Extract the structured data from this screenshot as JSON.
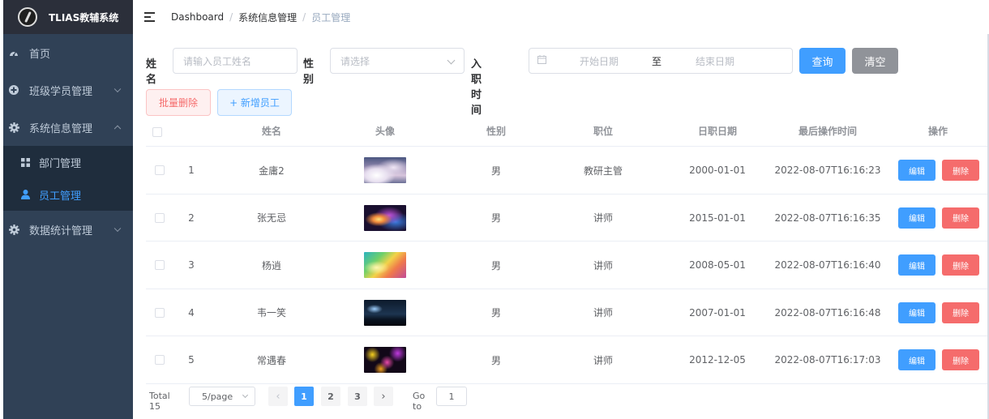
{
  "brand": {
    "title": "TLIAS教辅系统"
  },
  "sidebar": {
    "items": [
      {
        "label": "首页",
        "icon": "dashboard-icon"
      },
      {
        "label": "班级学员管理",
        "icon": "plus-circle-icon",
        "expanded": false
      },
      {
        "label": "系统信息管理",
        "icon": "gear-icon",
        "expanded": true,
        "children": [
          {
            "label": "部门管理",
            "icon": "grid-icon",
            "active": false
          },
          {
            "label": "员工管理",
            "icon": "user-icon",
            "active": true
          }
        ]
      },
      {
        "label": "数据统计管理",
        "icon": "gear-icon",
        "expanded": false
      }
    ]
  },
  "breadcrumb": [
    "Dashboard",
    "系统信息管理",
    "员工管理"
  ],
  "search": {
    "name_label": "姓名",
    "name_placeholder": "请输入员工姓名",
    "gender_label": "性别",
    "gender_placeholder": "请选择",
    "date_label": "入职时间",
    "start_placeholder": "开始日期",
    "range_sep": "至",
    "end_placeholder": "结束日期",
    "query_label": "查询",
    "clear_label": "清空"
  },
  "actions": {
    "batch_delete": "批量删除",
    "add_employee": "+ 新增员工"
  },
  "table": {
    "columns": [
      "姓名",
      "头像",
      "性别",
      "职位",
      "日职日期",
      "最后操作时间",
      "操作"
    ],
    "edit_label": "编辑",
    "delete_label": "删除",
    "rows": [
      {
        "index": "1",
        "name": "金庸2",
        "gender": "男",
        "job": "教研主管",
        "entry_date": "2000-01-01",
        "update_time": "2022-08-07T16:16:23",
        "avatar": "clouds-photo"
      },
      {
        "index": "2",
        "name": "张无忌",
        "gender": "男",
        "job": "讲师",
        "entry_date": "2015-01-01",
        "update_time": "2022-08-07T16:16:35",
        "avatar": "nebula-photo"
      },
      {
        "index": "3",
        "name": "杨逍",
        "gender": "男",
        "job": "讲师",
        "entry_date": "2008-05-01",
        "update_time": "2022-08-07T16:16:40",
        "avatar": "rainbow-clouds-photo"
      },
      {
        "index": "4",
        "name": "韦一笑",
        "gender": "男",
        "job": "讲师",
        "entry_date": "2007-01-01",
        "update_time": "2022-08-07T16:16:48",
        "avatar": "night-city-photo"
      },
      {
        "index": "5",
        "name": "常遇春",
        "gender": "男",
        "job": "讲师",
        "entry_date": "2012-12-05",
        "update_time": "2022-08-07T16:17:03",
        "avatar": "fireworks-photo"
      }
    ]
  },
  "pagination": {
    "total_label": "Total 15",
    "page_size": "5/page",
    "pages": [
      "1",
      "2",
      "3"
    ],
    "current_page": "1",
    "goto_label": "Go to",
    "goto_value": "1"
  },
  "colors": {
    "primary": "#409eff",
    "danger": "#f56c6c",
    "info": "#909399",
    "sidebar": "#304156"
  }
}
